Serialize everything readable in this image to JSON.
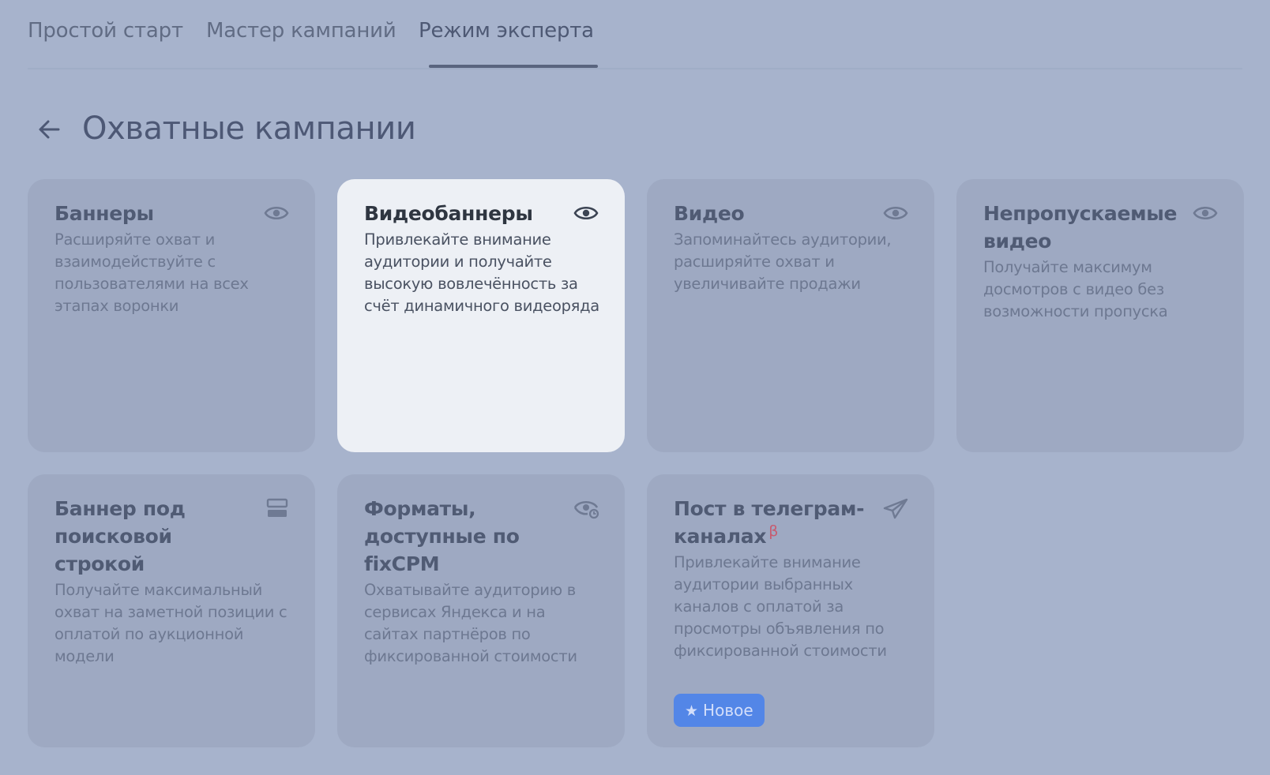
{
  "tabs": [
    {
      "label": "Простой старт"
    },
    {
      "label": "Мастер кампаний"
    },
    {
      "label": "Режим эксперта"
    }
  ],
  "page": {
    "title": "Охватные кампании",
    "back_icon": "arrow-left-icon"
  },
  "cards": [
    {
      "title": "Баннеры",
      "description": "Расширяйте охват и взаимодействуйте с пользователями на всех этапах воронки",
      "icon": "eye-icon"
    },
    {
      "title": "Видеобаннеры",
      "description": "Привлекайте внимание аудитории и получайте высокую вовлечённость за счёт динамичного видеоряда",
      "icon": "eye-icon"
    },
    {
      "title": "Видео",
      "description": "Запоминайтесь аудитории, расширяйте охват и увеличивайте продажи",
      "icon": "eye-icon"
    },
    {
      "title": "Непропускаемые видео",
      "description": "Получайте максимум досмотров с видео без возможности пропуска",
      "icon": "eye-icon"
    },
    {
      "title": "Баннер под поисковой строкой",
      "description": "Получайте максимальный охват на заметной позиции с оплатой по аукционной модели",
      "icon": "search-banner-icon"
    },
    {
      "title": "Форматы, доступные по fixCPM",
      "description": "Охватывайте аудиторию в сервисах Яндекса и на сайтах партнёров по фиксированной стоимости",
      "icon": "eye-refresh-icon"
    },
    {
      "title": "Пост в телеграм-каналах",
      "beta": "β",
      "description": "Привлекайте внимание аудитории выбранных каналов с оплатой за просмотры объявления по фиксированной стоимости",
      "icon": "telegram-icon",
      "badge": "Новое",
      "badge_icon": "star-icon"
    }
  ],
  "colors": {
    "background": "#a7b3cc",
    "card": "#9ea9c2",
    "card_highlight": "#edf0f5",
    "badge": "#5386e7",
    "beta": "#c75b6f"
  }
}
